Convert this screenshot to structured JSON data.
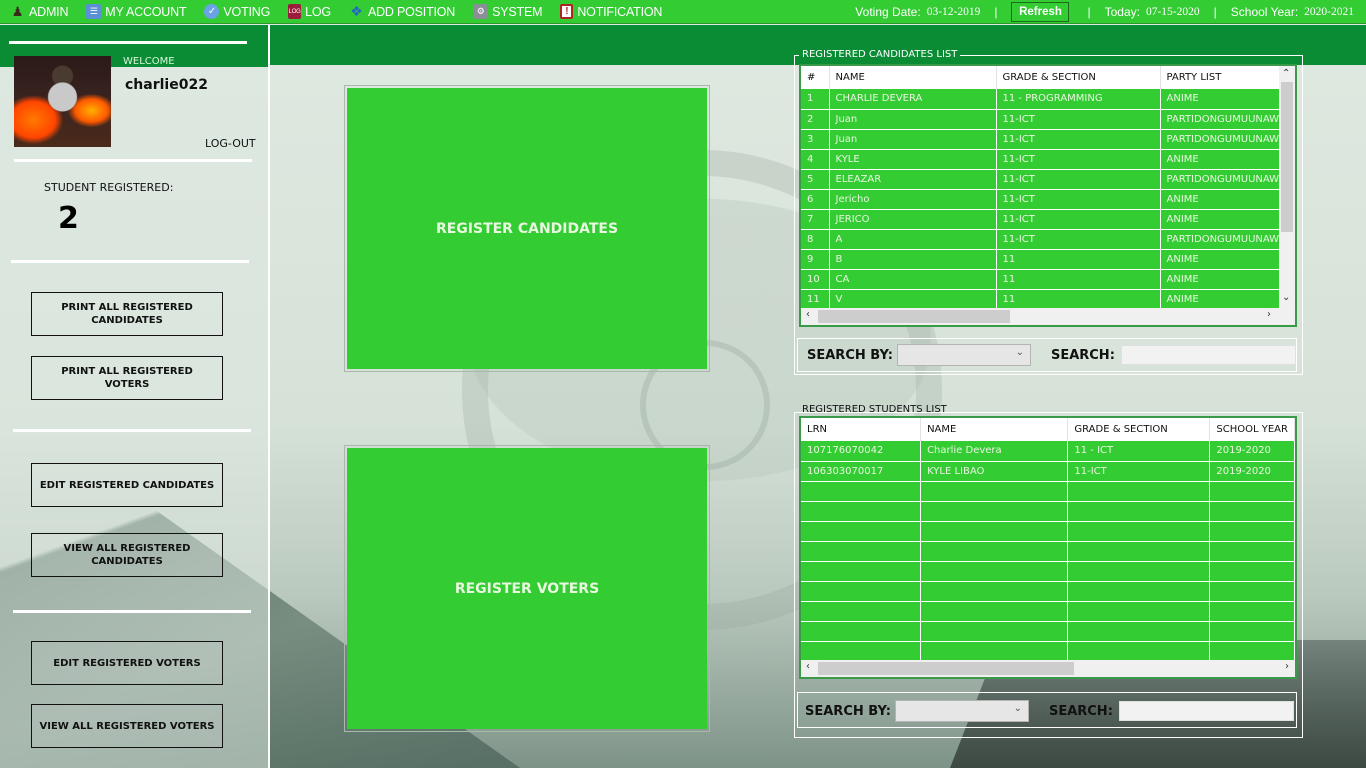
{
  "nav": {
    "items": [
      {
        "label": "ADMIN",
        "icon": "admin-icon"
      },
      {
        "label": "MY ACCOUNT",
        "icon": "account-icon"
      },
      {
        "label": "VOTING",
        "icon": "voting-icon"
      },
      {
        "label": "LOG",
        "icon": "log-icon"
      },
      {
        "label": "ADD POSITION",
        "icon": "add-position-icon"
      },
      {
        "label": "SYSTEM",
        "icon": "system-icon"
      },
      {
        "label": "NOTIFICATION",
        "icon": "notification-icon"
      }
    ],
    "voting_date_label": "Voting Date:",
    "voting_date": "03-12-2019",
    "refresh_label": "Refresh",
    "today_label": "Today:",
    "today": "07-15-2020",
    "school_year_label": "School Year:",
    "school_year": "2020-2021",
    "separator": "|"
  },
  "sidebar": {
    "welcome": "WELCOME",
    "username": "charlie022",
    "logout": "LOG-OUT",
    "student_registered_label": "STUDENT REGISTERED:",
    "student_registered_count": "2",
    "buttons": {
      "print_candidates": "PRINT ALL REGISTERED CANDIDATES",
      "print_voters": "PRINT ALL REGISTERED VOTERS",
      "edit_candidates": "EDIT REGISTERED CANDIDATES",
      "view_candidates": "VIEW ALL REGISTERED CANDIDATES",
      "edit_voters": "EDIT REGISTERED VOTERS",
      "view_voters": "VIEW ALL REGISTERED VOTERS"
    }
  },
  "main": {
    "register_candidates": "REGISTER CANDIDATES",
    "register_voters": "REGISTER VOTERS"
  },
  "candidates": {
    "title": "REGISTERED CANDIDATES LIST",
    "columns": [
      "#",
      "NAME",
      "GRADE & SECTION",
      "PARTY LIST"
    ],
    "rows": [
      [
        "1",
        "CHARLIE DEVERA",
        "11 - PROGRAMMING",
        "ANIME"
      ],
      [
        "2",
        "Juan",
        "11-ICT",
        "PARTIDONGUMUUNAW"
      ],
      [
        "3",
        "Juan",
        "11-ICT",
        "PARTIDONGUMUUNAW"
      ],
      [
        "4",
        "KYLE",
        "11-ICT",
        "ANIME"
      ],
      [
        "5",
        "ELEAZAR",
        "11-ICT",
        "PARTIDONGUMUUNAW"
      ],
      [
        "6",
        "Jericho",
        "11-ICT",
        "ANIME"
      ],
      [
        "7",
        "JERICO",
        "11-ICT",
        "ANIME"
      ],
      [
        "8",
        "A",
        "11-ICT",
        "PARTIDONGUMUUNAW"
      ],
      [
        "9",
        "B",
        "11",
        "ANIME"
      ],
      [
        "10",
        "CA",
        "11",
        "ANIME"
      ],
      [
        "11",
        "V",
        "11",
        "ANIME"
      ]
    ],
    "search_by_label": "SEARCH BY:",
    "search_by_value": "",
    "search_label": "SEARCH:",
    "search_value": ""
  },
  "students": {
    "title": "REGISTERED STUDENTS LIST",
    "columns": [
      "LRN",
      "NAME",
      "GRADE & SECTION",
      "SCHOOL YEAR"
    ],
    "rows": [
      [
        "107176070042",
        "Charlie Devera",
        "11 - ICT",
        "2019-2020"
      ],
      [
        "106303070017",
        "KYLE LIBAO",
        "11-ICT",
        "2019-2020"
      ],
      [
        "",
        "",
        "",
        ""
      ],
      [
        "",
        "",
        "",
        ""
      ],
      [
        "",
        "",
        "",
        ""
      ],
      [
        "",
        "",
        "",
        ""
      ],
      [
        "",
        "",
        "",
        ""
      ],
      [
        "",
        "",
        "",
        ""
      ],
      [
        "",
        "",
        "",
        ""
      ],
      [
        "",
        "",
        "",
        ""
      ],
      [
        "",
        "",
        "",
        ""
      ]
    ],
    "search_by_label": "SEARCH BY:",
    "search_by_value": "",
    "search_label": "SEARCH:",
    "search_value": ""
  },
  "colors": {
    "nav_green": "#33cc33",
    "dark_green": "#0a8c35",
    "cell_green": "#33cc33"
  }
}
